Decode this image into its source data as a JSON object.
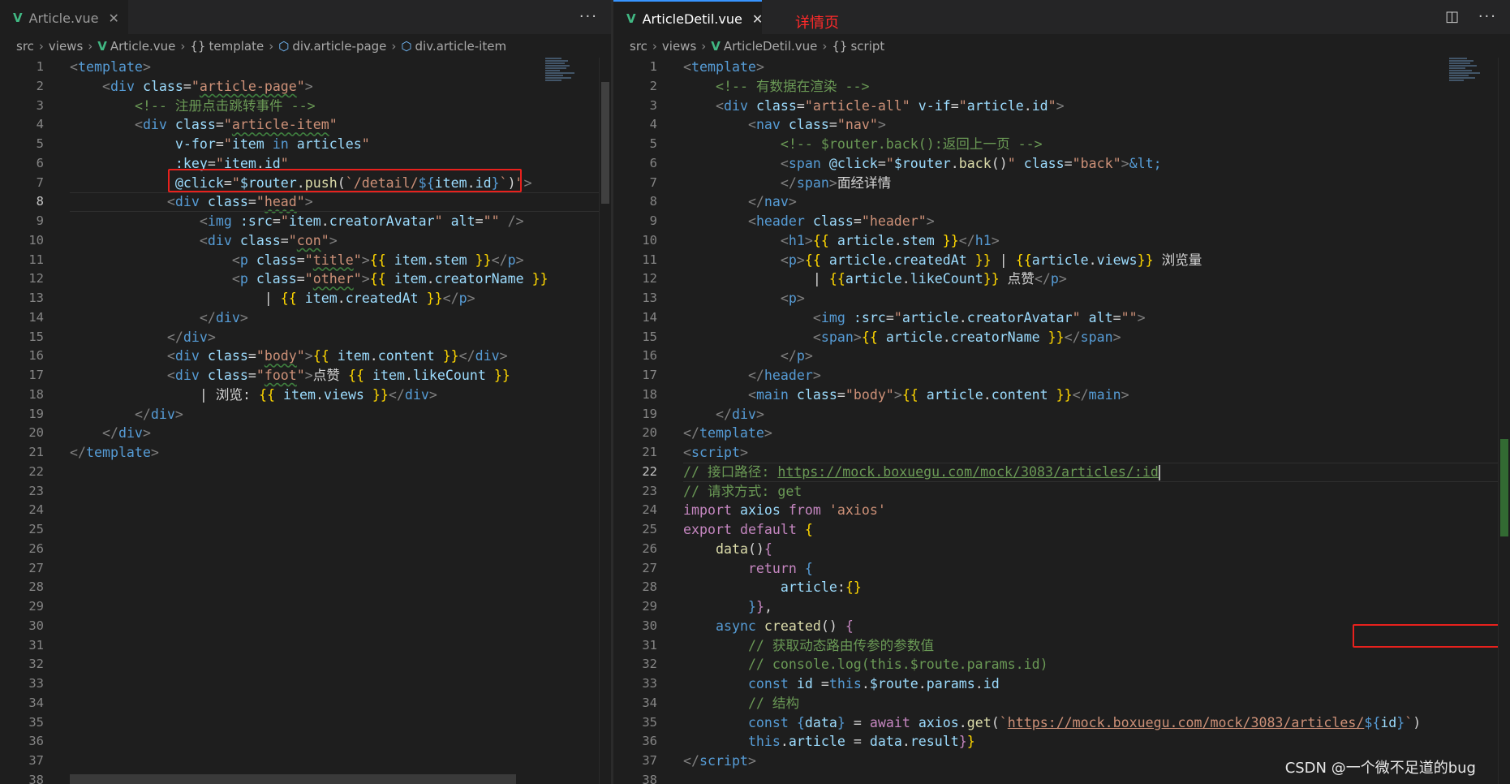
{
  "left": {
    "tab_label": "Article.vue",
    "tab_close": "✕",
    "breadcrumb": [
      "src",
      "views",
      "Article.vue",
      "template",
      "div.article-page",
      "div.article-item"
    ],
    "active_line": 8,
    "line_count": 38
  },
  "right": {
    "tab_label": "ArticleDetil.vue",
    "tab_close": "✕",
    "annotation": "详情页",
    "breadcrumb": [
      "src",
      "views",
      "ArticleDetil.vue",
      "script"
    ],
    "active_line": 22,
    "line_count": 38
  },
  "tab_actions": {
    "split": "◫",
    "more": "···"
  },
  "left_more": "···",
  "watermark": "CSDN @一个微不足道的bug",
  "colors": {
    "highlight_box": "#e8211d",
    "vue_green": "#41b883",
    "editor_bg": "#1e1e1e",
    "annotation": "#ff2a2a"
  }
}
